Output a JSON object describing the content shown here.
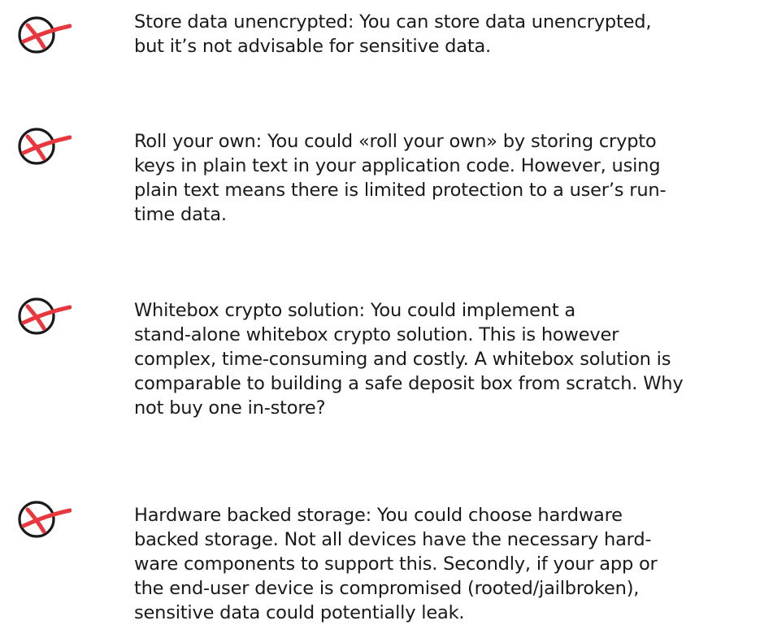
{
  "colors": {
    "text": "#1a1a1a",
    "icon_outline": "#1a1a1a",
    "icon_mark": "#e8383d"
  },
  "icons": {
    "rejected": "circled-x-icon"
  },
  "items": [
    {
      "lines": [
        "Store data unencrypted: You can store data unencrypted,",
        "but it’s not advisable for sensitive data."
      ]
    },
    {
      "lines": [
        "Roll your own: You could «roll your own» by storing crypto",
        "keys in plain text in your application code. However, using",
        "plain text means there is limited protection to a user’s run-",
        "time data."
      ]
    },
    {
      "lines": [
        "Whitebox crypto solution: You could implement a",
        "stand-alone whitebox crypto solution. This is however",
        "complex, time-consuming and costly. A whitebox solution is",
        "comparable to building a safe deposit box from scratch. Why",
        "not buy one in-store?"
      ]
    },
    {
      "lines": [
        "Hardware backed storage: You could choose hardware",
        "backed storage. Not all devices have the necessary hard-",
        "ware components to support this. Secondly, if your app or",
        "the end-user device is compromised (rooted/jailbroken),",
        "sensitive data could potentially leak."
      ]
    }
  ]
}
